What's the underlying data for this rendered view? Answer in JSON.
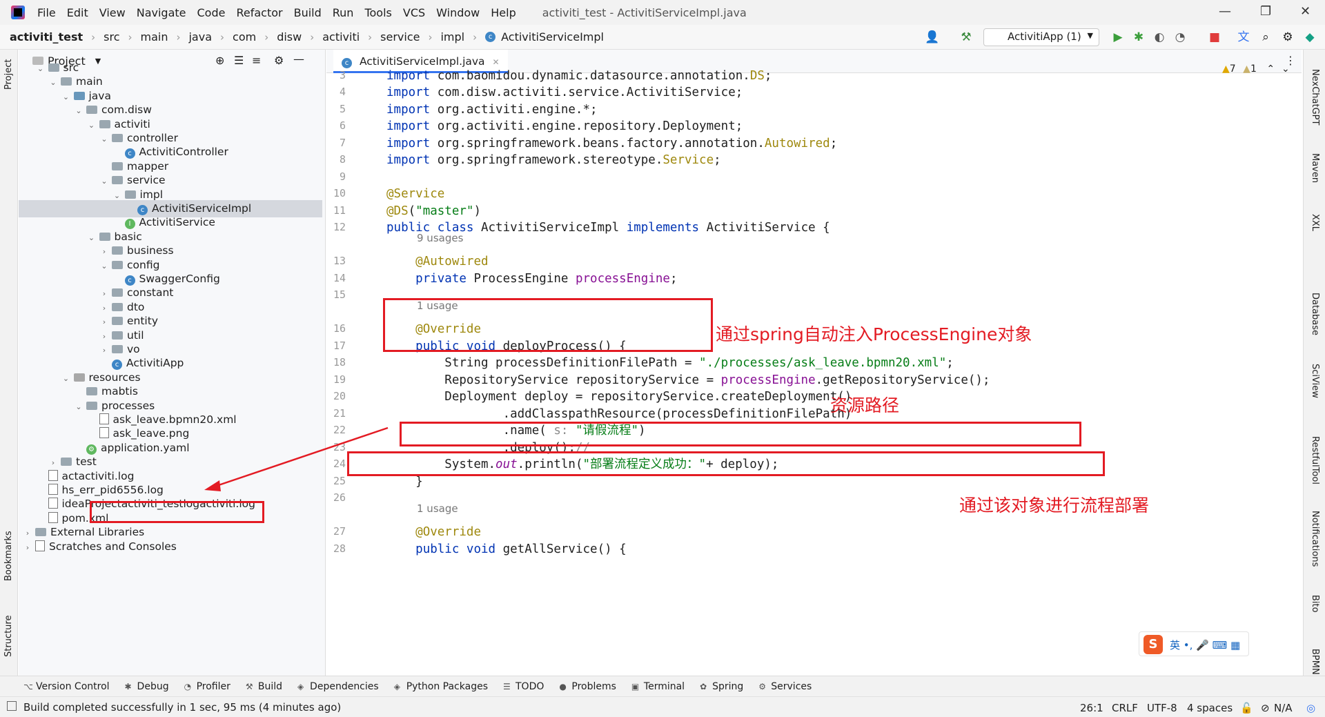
{
  "menubar": {
    "items": [
      "File",
      "Edit",
      "View",
      "Navigate",
      "Code",
      "Refactor",
      "Build",
      "Run",
      "Tools",
      "VCS",
      "Window",
      "Help"
    ],
    "title": "activiti_test - ActivitiServiceImpl.java"
  },
  "breadcrumb": [
    "activiti_test",
    "src",
    "main",
    "java",
    "com",
    "disw",
    "activiti",
    "service",
    "impl",
    "ActivitiServiceImpl"
  ],
  "run_config": "ActivitiApp (1)",
  "project_panel": {
    "title": "Project",
    "tree": [
      {
        "label": "src",
        "type": "folder",
        "arrow": "⌄"
      },
      {
        "label": "main",
        "type": "folder",
        "arrow": "⌄"
      },
      {
        "label": "java",
        "type": "src",
        "arrow": "⌄"
      },
      {
        "label": "com.disw",
        "type": "package",
        "arrow": "⌄"
      },
      {
        "label": "activiti",
        "type": "package",
        "arrow": "⌄"
      },
      {
        "label": "controller",
        "type": "package",
        "arrow": "⌄"
      },
      {
        "label": "ActivitiController",
        "type": "class",
        "arrow": ""
      },
      {
        "label": "mapper",
        "type": "package",
        "arrow": ""
      },
      {
        "label": "service",
        "type": "package",
        "arrow": "⌄"
      },
      {
        "label": "impl",
        "type": "package",
        "arrow": "⌄"
      },
      {
        "label": "ActivitiServiceImpl",
        "type": "class",
        "arrow": ""
      },
      {
        "label": "ActivitiService",
        "type": "interface",
        "arrow": ""
      },
      {
        "label": "basic",
        "type": "package",
        "arrow": "⌄"
      },
      {
        "label": "business",
        "type": "package",
        "arrow": "›"
      },
      {
        "label": "config",
        "type": "package",
        "arrow": "⌄"
      },
      {
        "label": "SwaggerConfig",
        "type": "class",
        "arrow": ""
      },
      {
        "label": "constant",
        "type": "package",
        "arrow": "›"
      },
      {
        "label": "dto",
        "type": "package",
        "arrow": "›"
      },
      {
        "label": "entity",
        "type": "package",
        "arrow": "›"
      },
      {
        "label": "util",
        "type": "package",
        "arrow": "›"
      },
      {
        "label": "vo",
        "type": "package",
        "arrow": "›"
      },
      {
        "label": "ActivitiApp",
        "type": "app",
        "arrow": ""
      },
      {
        "label": "resources",
        "type": "res",
        "arrow": "⌄"
      },
      {
        "label": "mabtis",
        "type": "folder",
        "arrow": ""
      },
      {
        "label": "processes",
        "type": "folder",
        "arrow": "⌄"
      },
      {
        "label": "ask_leave.bpmn20.xml",
        "type": "bpmn",
        "arrow": ""
      },
      {
        "label": "ask_leave.png",
        "type": "file",
        "arrow": ""
      },
      {
        "label": "application.yaml",
        "type": "yaml",
        "arrow": ""
      },
      {
        "label": "test",
        "type": "folder",
        "arrow": "›"
      },
      {
        "label": "actactiviti.log",
        "type": "file",
        "arrow": ""
      },
      {
        "label": "hs_err_pid6556.log",
        "type": "file",
        "arrow": ""
      },
      {
        "label": "ideaProjectactiviti_testlogactiviti.log",
        "type": "file",
        "arrow": ""
      },
      {
        "label": "pom.xml",
        "type": "maven",
        "arrow": ""
      },
      {
        "label": "External Libraries",
        "type": "lib",
        "arrow": "›"
      },
      {
        "label": "Scratches and Consoles",
        "type": "scratch",
        "arrow": "›"
      }
    ]
  },
  "editor": {
    "tab": "ActivitiServiceImpl.java",
    "inspections": {
      "warnings": "7",
      "weak": "1"
    },
    "lines": [
      {
        "n": "3",
        "html": "<span class='kw'>import</span> com.baomidou.dynamic.datasource.annotation.<span class='ann'>DS</span>;"
      },
      {
        "n": "4",
        "html": "<span class='kw'>import</span> com.disw.activiti.service.ActivitiService;"
      },
      {
        "n": "5",
        "html": "<span class='kw'>import</span> org.activiti.engine.*;"
      },
      {
        "n": "6",
        "html": "<span class='kw'>import</span> org.activiti.engine.repository.Deployment;"
      },
      {
        "n": "7",
        "html": "<span class='kw'>import</span> org.springframework.beans.factory.annotation.<span class='ann'>Autowired</span>;"
      },
      {
        "n": "8",
        "html": "<span class='kw'>import</span> org.springframework.stereotype.<span class='ann'>Service</span>;"
      },
      {
        "n": "9",
        "html": ""
      },
      {
        "n": "10",
        "html": "<span class='ann'>@Service</span>"
      },
      {
        "n": "11",
        "html": "<span class='ann'>@DS</span>(<span class='str'>\"master\"</span>)"
      },
      {
        "n": "12",
        "html": "<span class='kw'>public class</span> ActivitiServiceImpl <span class='kw'>implements</span> ActivitiService {"
      },
      {
        "n": "13",
        "html": "    <span class='ann'>@Autowired</span>"
      },
      {
        "n": "14",
        "html": "    <span class='kw'>private</span> ProcessEngine <span class='fld'>processEngine</span>;"
      },
      {
        "n": "15",
        "html": ""
      },
      {
        "n": "16",
        "html": "    <span class='ann'>@Override</span>"
      },
      {
        "n": "17",
        "html": "    <span class='kw'>public void</span> deployProcess() {"
      },
      {
        "n": "18",
        "html": "        String processDefinitionFilePath = <span class='str'>\"./processes/ask_leave.bpmn20.xml\"</span>;"
      },
      {
        "n": "19",
        "html": "        RepositoryService repositoryService = <span class='fld'>processEngine</span>.getRepositoryService();"
      },
      {
        "n": "20",
        "html": "        Deployment deploy = repositoryService.createDeployment()"
      },
      {
        "n": "21",
        "html": "                .addClasspathResource(processDefinitionFilePath)"
      },
      {
        "n": "22",
        "html": "                .name( <span class='cmt'>s:</span> <span class='str'>\"请假流程\"</span>)"
      },
      {
        "n": "23",
        "html": "                .deploy();<span class='cmt'>//</span>"
      },
      {
        "n": "24",
        "html": "        System.<span class='fld'><i>out</i></span>.println(<span class='str'>\"部署流程定义成功：\"</span>+ deploy);"
      },
      {
        "n": "25",
        "html": "    }"
      },
      {
        "n": "26",
        "html": ""
      },
      {
        "n": "27",
        "html": "    <span class='ann'>@Override</span>"
      },
      {
        "n": "28",
        "html": "    <span class='kw'>public void</span> getAllService() {"
      }
    ],
    "usage_hints": [
      "9 usages",
      "1 usage",
      "1 usage"
    ]
  },
  "annotations": {
    "note1": "通过spring自动注入ProcessEngine对象",
    "note2": "资源路径",
    "note3": "通过该对象进行流程部署"
  },
  "right_stripe": [
    "NexChatGPT",
    "Maven",
    "XXL",
    "Database",
    "SciView",
    "RestfulTool",
    "Notifications",
    "Bito",
    "BPMN"
  ],
  "left_stripe": [
    "Project",
    "Bookmarks",
    "Structure"
  ],
  "bottom_tools": [
    {
      "icon": "⌥",
      "label": "Version Control"
    },
    {
      "icon": "✱",
      "label": "Debug"
    },
    {
      "icon": "◔",
      "label": "Profiler"
    },
    {
      "icon": "⚒",
      "label": "Build"
    },
    {
      "icon": "◈",
      "label": "Dependencies"
    },
    {
      "icon": "◈",
      "label": "Python Packages"
    },
    {
      "icon": "☰",
      "label": "TODO"
    },
    {
      "icon": "●",
      "label": "Problems"
    },
    {
      "icon": "▣",
      "label": "Terminal"
    },
    {
      "icon": "✿",
      "label": "Spring"
    },
    {
      "icon": "⚙",
      "label": "Services"
    }
  ],
  "status": {
    "message": "Build completed successfully in 1 sec, 95 ms (4 minutes ago)",
    "position": "26:1",
    "line_sep": "CRLF",
    "encoding": "UTF-8",
    "indent": "4 spaces",
    "vcs": "N/A"
  },
  "ime": {
    "logo": "S",
    "text": "英 •, 🎤 ⌨ ▦"
  }
}
